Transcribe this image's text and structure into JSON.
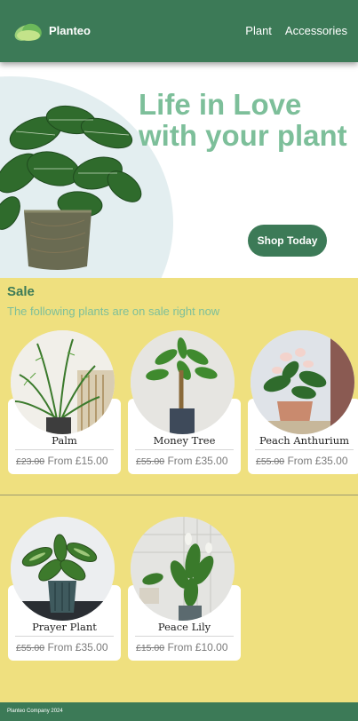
{
  "header": {
    "brand": "Planteo",
    "nav": [
      "Plant",
      "Accessories"
    ]
  },
  "hero": {
    "title_line1": "Life in Love",
    "title_line2": "with your plant",
    "cta": "Shop Today"
  },
  "sale": {
    "title": "Sale",
    "subtitle": "The following plants are on sale right now",
    "items": [
      {
        "name": "Palm",
        "old_price": "£23.00",
        "new_price": "From £15.00"
      },
      {
        "name": "Money Tree",
        "old_price": "£55.00",
        "new_price": "From £35.00"
      },
      {
        "name": "Peach Anthurium",
        "old_price": "£55.00",
        "new_price": "From £35.00"
      },
      {
        "name": "Prayer Plant",
        "old_price": "£55.00",
        "new_price": "From £35.00"
      },
      {
        "name": "Peace Lily",
        "old_price": "£15.00",
        "new_price": "From £10.00"
      }
    ]
  },
  "footer": {
    "text": "Planteo Company 2024"
  },
  "colors": {
    "brand_green": "#3c7a57",
    "light_green": "#7dbf9a",
    "sale_yellow": "#efe07f"
  }
}
